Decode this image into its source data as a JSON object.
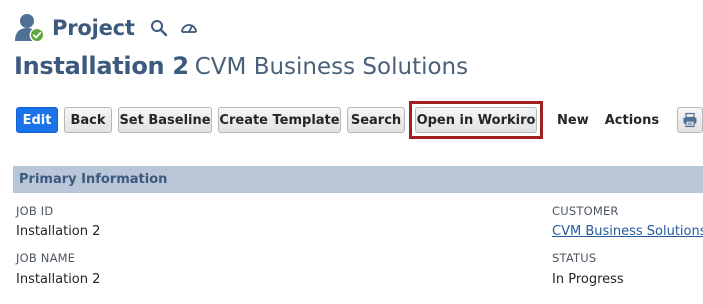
{
  "header": {
    "record_type": "Project",
    "icons": [
      "project-user-check-icon",
      "search-icon",
      "dashboard-gauge-icon"
    ]
  },
  "title": {
    "name": "Installation 2",
    "company": "CVM Business Solutions"
  },
  "toolbar": {
    "edit": "Edit",
    "back": "Back",
    "set_baseline": "Set Baseline",
    "create_template": "Create Template",
    "search": "Search",
    "open_in_workiro": "Open in Workiro",
    "new": "New",
    "actions": "Actions",
    "print_icon": "printer-icon"
  },
  "section": {
    "title": "Primary Information"
  },
  "fields": {
    "job_id": {
      "label": "JOB ID",
      "value": "Installation 2"
    },
    "job_name": {
      "label": "JOB NAME",
      "value": "Installation 2"
    },
    "customer": {
      "label": "CUSTOMER",
      "value": "CVM Business Solutions"
    },
    "status": {
      "label": "STATUS",
      "value": "In Progress"
    }
  },
  "colors": {
    "brand": "#3c5a7d",
    "primary_button": "#1a73e8",
    "highlight": "#a0201d",
    "section_bg": "#b9c6d7",
    "link": "#255a9b"
  }
}
